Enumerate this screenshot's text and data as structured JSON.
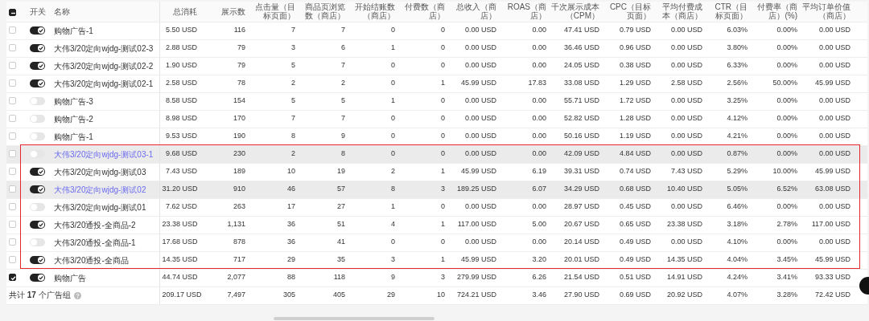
{
  "header": {
    "select_all_partial": true,
    "columns": [
      "开关",
      "名称",
      "总消耗",
      "展示数",
      "点击量（目标页面）",
      "商品页浏览数（商店）",
      "开始结账数（商店）",
      "付费数（商店）",
      "总收入（商店）",
      "ROAS（商店）",
      "千次展示成本（CPM）",
      "CPC（目标页面）",
      "平均付费成本（商店）",
      "CTR（目标页面）",
      "付费率（商店）(%)",
      "平均订单价值（商店）"
    ]
  },
  "row_groups": [
    {
      "framed": false,
      "rows": [
        {
          "selected": false,
          "on": true,
          "highlighted": false,
          "name": "购物广告-1",
          "cells": [
            "5.50 USD",
            "116",
            "7",
            "7",
            "0",
            "0",
            "0.00 USD",
            "0.00",
            "47.41 USD",
            "0.79 USD",
            "0.00 USD",
            "6.03%",
            "0.00%",
            "0.00 USD"
          ]
        },
        {
          "selected": false,
          "on": true,
          "highlighted": false,
          "name": "大伟3/20定向wjdg-测试02-3",
          "cells": [
            "2.88 USD",
            "79",
            "3",
            "6",
            "1",
            "0",
            "0.00 USD",
            "0.00",
            "36.46 USD",
            "0.96 USD",
            "0.00 USD",
            "3.80%",
            "0.00%",
            "0.00 USD"
          ]
        },
        {
          "selected": false,
          "on": true,
          "highlighted": false,
          "name": "大伟3/20定向wjdg-测试02-2",
          "cells": [
            "1.90 USD",
            "79",
            "5",
            "7",
            "0",
            "0",
            "0.00 USD",
            "0.00",
            "24.05 USD",
            "0.38 USD",
            "0.00 USD",
            "6.33%",
            "0.00%",
            "0.00 USD"
          ]
        },
        {
          "selected": false,
          "on": true,
          "highlighted": false,
          "name": "大伟3/20定向wjdg-测试02-1",
          "cells": [
            "2.58 USD",
            "78",
            "2",
            "2",
            "0",
            "1",
            "45.99 USD",
            "17.83",
            "33.08 USD",
            "1.29 USD",
            "2.58 USD",
            "2.56%",
            "50.00%",
            "45.99 USD"
          ]
        },
        {
          "selected": false,
          "on": false,
          "highlighted": false,
          "name": "购物广告-3",
          "cells": [
            "8.58 USD",
            "154",
            "5",
            "5",
            "1",
            "0",
            "0.00 USD",
            "0.00",
            "55.71 USD",
            "1.72 USD",
            "0.00 USD",
            "3.25%",
            "0.00%",
            "0.00 USD"
          ]
        },
        {
          "selected": false,
          "on": false,
          "highlighted": false,
          "name": "购物广告-2",
          "cells": [
            "8.98 USD",
            "170",
            "7",
            "7",
            "0",
            "0",
            "0.00 USD",
            "0.00",
            "52.82 USD",
            "1.28 USD",
            "0.00 USD",
            "4.12%",
            "0.00%",
            "0.00 USD"
          ]
        },
        {
          "selected": false,
          "on": false,
          "highlighted": false,
          "name": "购物广告-1",
          "cells": [
            "9.53 USD",
            "190",
            "8",
            "9",
            "0",
            "0",
            "0.00 USD",
            "0.00",
            "50.16 USD",
            "1.19 USD",
            "0.00 USD",
            "4.21%",
            "0.00%",
            "0.00 USD"
          ]
        }
      ]
    },
    {
      "framed": true,
      "rows": [
        {
          "selected": false,
          "on": false,
          "highlighted": true,
          "name": "大伟3/20定向wjdg-测试03-1",
          "cells": [
            "9.68 USD",
            "230",
            "2",
            "8",
            "0",
            "0",
            "0.00 USD",
            "0.00",
            "42.09 USD",
            "4.84 USD",
            "0.00 USD",
            "0.87%",
            "0.00%",
            "0.00 USD"
          ]
        },
        {
          "selected": false,
          "on": true,
          "highlighted": false,
          "name": "大伟3/20定向wjdg-测试03",
          "cells": [
            "7.43 USD",
            "189",
            "10",
            "19",
            "2",
            "1",
            "45.99 USD",
            "6.19",
            "39.31 USD",
            "0.74 USD",
            "7.43 USD",
            "5.29%",
            "10.00%",
            "45.99 USD"
          ]
        },
        {
          "selected": false,
          "on": true,
          "highlighted": true,
          "name": "大伟3/20定向wjdg-测试02",
          "cells": [
            "31.20 USD",
            "910",
            "46",
            "57",
            "8",
            "3",
            "189.25 USD",
            "6.07",
            "34.29 USD",
            "0.68 USD",
            "10.40 USD",
            "5.05%",
            "6.52%",
            "63.08 USD"
          ]
        },
        {
          "selected": false,
          "on": false,
          "highlighted": false,
          "name": "大伟3/20定向wjdg-测试01",
          "cells": [
            "7.62 USD",
            "263",
            "17",
            "27",
            "1",
            "0",
            "0.00 USD",
            "0.00",
            "28.97 USD",
            "0.45 USD",
            "0.00 USD",
            "6.46%",
            "0.00%",
            "0.00 USD"
          ]
        },
        {
          "selected": false,
          "on": true,
          "highlighted": false,
          "name": "大伟3/20通投-全商品-2",
          "cells": [
            "23.38 USD",
            "1,131",
            "36",
            "51",
            "4",
            "1",
            "117.00 USD",
            "5.00",
            "20.67 USD",
            "0.65 USD",
            "23.38 USD",
            "3.18%",
            "2.78%",
            "117.00 USD"
          ]
        },
        {
          "selected": false,
          "on": false,
          "highlighted": false,
          "name": "大伟3/20通投-全商品-1",
          "cells": [
            "17.68 USD",
            "878",
            "36",
            "41",
            "0",
            "0",
            "0.00 USD",
            "0.00",
            "20.14 USD",
            "0.49 USD",
            "0.00 USD",
            "4.10%",
            "0.00%",
            "0.00 USD"
          ]
        },
        {
          "selected": false,
          "on": true,
          "highlighted": false,
          "name": "大伟3/20通投-全商品",
          "cells": [
            "14.35 USD",
            "717",
            "29",
            "35",
            "3",
            "1",
            "45.99 USD",
            "3.20",
            "20.01 USD",
            "0.49 USD",
            "14.35 USD",
            "4.04%",
            "3.45%",
            "45.99 USD"
          ]
        }
      ]
    },
    {
      "framed": false,
      "rows": [
        {
          "selected": true,
          "on": true,
          "highlighted": false,
          "name": "购物广告",
          "cells": [
            "44.74 USD",
            "2,077",
            "88",
            "118",
            "9",
            "3",
            "279.99 USD",
            "6.26",
            "21.54 USD",
            "0.51 USD",
            "14.91 USD",
            "4.24%",
            "3.41%",
            "93.33 USD"
          ]
        }
      ]
    }
  ],
  "total": {
    "label": "共计 **17** 个广告组",
    "cells": [
      "209.17 USD",
      "7,497",
      "305",
      "405",
      "29",
      "10",
      "724.21 USD",
      "3.46",
      "27.90 USD",
      "0.69 USD",
      "20.92 USD",
      "4.07%",
      "3.28%",
      "72.42 USD"
    ]
  }
}
